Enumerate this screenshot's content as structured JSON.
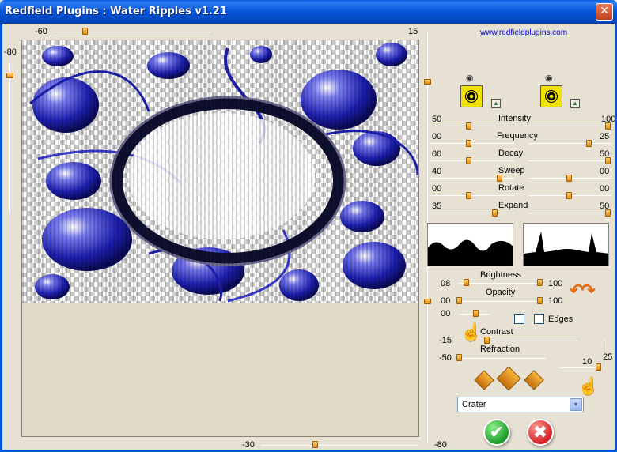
{
  "window": {
    "title": "Redfield Plugins : Water Ripples v1.21",
    "close_glyph": "✕"
  },
  "top_slider": {
    "min_label": "-60",
    "value_label": "15"
  },
  "left_slider": {
    "label": "-80"
  },
  "bottom_slider": {
    "label": "-30"
  },
  "right_slider": {
    "label": "-80"
  },
  "link": "www.redfieldplugins.com",
  "swatches": {
    "left_icon": "eye-icon",
    "right_icon": "eye-icon",
    "triangle_glyph": "▲"
  },
  "params": [
    {
      "name": "Intensity",
      "left": "50",
      "right": "100"
    },
    {
      "name": "Frequency",
      "left": "00",
      "right": "25"
    },
    {
      "name": "Decay",
      "left": "00",
      "right": "50"
    },
    {
      "name": "Sweep",
      "left": "40",
      "right": "00"
    },
    {
      "name": "Rotate",
      "left": "00",
      "right": "00"
    },
    {
      "name": "Expand",
      "left": "35",
      "right": "50"
    }
  ],
  "lighting": {
    "brightness_label": "Brightness",
    "brightness_left": "08",
    "brightness_right": "100",
    "opacity_label": "Opacity",
    "opacity_left": "00",
    "opacity_right": "100",
    "third_left": "00",
    "edges_label": "Edges",
    "contrast_label": "Contrast",
    "contrast_value": "-15",
    "refraction_label": "Refraction",
    "refraction_value": "-50",
    "right_value": "10",
    "far_right_value": "25"
  },
  "mode_select": {
    "value": "Crater",
    "arrow_glyph": "▾"
  },
  "buttons": {
    "ok_glyph": "✔",
    "cancel_glyph": "✖"
  },
  "colors": {
    "titlebar": "#0553d6",
    "panel": "#e7e1d4",
    "thumb": "#f0a020",
    "ripple_blue": "#2a2ed0"
  }
}
